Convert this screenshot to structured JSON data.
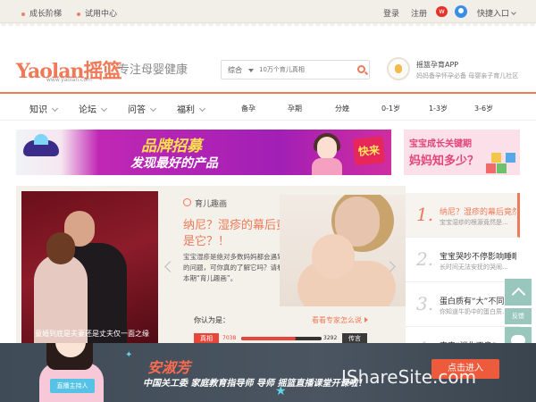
{
  "topbar": {
    "growth_ladder": "成长阶梯",
    "trial_center": "试用中心",
    "login": "登录",
    "register": "注册",
    "weibo_icon": "weibo-icon",
    "quick_entry": "快捷入口"
  },
  "header": {
    "logo_text": "Yaolan摇篮",
    "logo_url": "www.yaolan.com",
    "slogan": "专注母婴健康",
    "search": {
      "scope": "综合",
      "placeholder": "10万个育儿真相"
    },
    "app": {
      "title": "摇篮孕育APP",
      "subtitle": "妈妈备孕怀孕必备 母婴亲子育儿社区"
    }
  },
  "nav": {
    "main": [
      "知识",
      "论坛",
      "问答",
      "福利"
    ],
    "categories": [
      "备孕",
      "孕期",
      "分娩",
      "0-1岁",
      "1-3岁",
      "3-6岁"
    ]
  },
  "banner": {
    "line1": "品牌招募",
    "line2": "发现最好的产品",
    "cta": "快来",
    "right_line1": "宝宝成长关键期",
    "right_line2": "妈妈知多少？"
  },
  "feature": {
    "left_caption": "童婚到底是夫妻还是丈夫仅一面之缘",
    "section_title": "育儿趣画",
    "title": "纳尼？湿疹的幕后竟然是它？！",
    "desc": "宝宝湿疹是绝对多数妈妈都会遇到的问题，可你真的了解它吗？请看本期“育儿趣画”。",
    "poll": {
      "question": "你认为是：",
      "link": "看看专家怎么说",
      "yes_label": "真相",
      "yes_count": "7038",
      "no_label": "传言",
      "no_count": "3292",
      "yes_ratio": 0.68
    }
  },
  "list": [
    {
      "num": "1.",
      "title": "纳尼？湿疹的幕后竟然是它",
      "desc": "宝宝湿疹的根源竟然是..."
    },
    {
      "num": "2.",
      "title": "宝宝哭吵不停影响睡眠",
      "desc": "长时间无法安抚的哭闹..."
    },
    {
      "num": "3.",
      "title": "蛋白质有“大”不同",
      "desc": "你知道牛奶中的蛋白质..."
    },
    {
      "num": "4.",
      "title": "宝宝“消化不良”",
      "desc": ""
    }
  ],
  "float": {
    "feedback": "反馈"
  },
  "bottom_ad": {
    "host_name": "安淑芳",
    "host_badge": "直播主持人",
    "line": "中国关工委 家庭教育指导师 导师 摇篮直播课堂开课啦！",
    "button": "点击进入"
  },
  "watermark": "IShareSite.com"
}
